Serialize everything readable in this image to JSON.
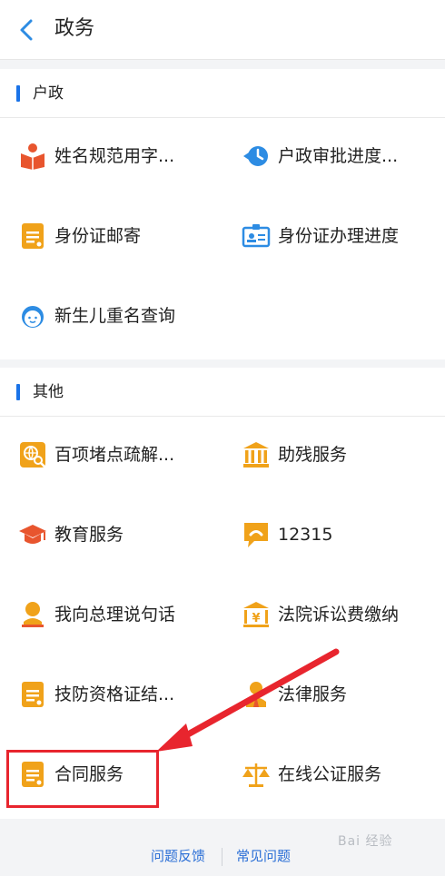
{
  "header": {
    "title": "政务"
  },
  "sections": [
    {
      "title": "户政",
      "items": [
        {
          "label": "姓名规范用字...",
          "icon": "reading-person-icon"
        },
        {
          "label": "户政审批进度...",
          "icon": "clock-refresh-icon"
        },
        {
          "label": "身份证邮寄",
          "icon": "document-icon"
        },
        {
          "label": "身份证办理进度",
          "icon": "id-card-icon"
        },
        {
          "label": "新生儿重名查询",
          "icon": "baby-face-icon"
        }
      ]
    },
    {
      "title": "其他",
      "items": [
        {
          "label": "百项堵点疏解...",
          "icon": "globe-search-icon"
        },
        {
          "label": "助残服务",
          "icon": "institution-icon"
        },
        {
          "label": "教育服务",
          "icon": "graduation-cap-icon"
        },
        {
          "label": "12315",
          "icon": "chat-phone-icon"
        },
        {
          "label": "我向总理说句话",
          "icon": "person-speak-icon"
        },
        {
          "label": "法院诉讼费缴纳",
          "icon": "court-fee-icon"
        },
        {
          "label": "技防资格证结...",
          "icon": "document-icon"
        },
        {
          "label": "法律服务",
          "icon": "lawyer-icon"
        },
        {
          "label": "合同服务",
          "icon": "document-icon"
        },
        {
          "label": "在线公证服务",
          "icon": "scales-icon"
        }
      ]
    }
  ],
  "footer": {
    "feedback": "问题反馈",
    "faq": "常见问题"
  },
  "watermark": "Bai 经验",
  "colors": {
    "accent": "#1a73e8",
    "icon_orange": "#f0a21a",
    "icon_red": "#e8552e",
    "icon_blue": "#2d8ce3",
    "highlight": "#e8252e"
  }
}
